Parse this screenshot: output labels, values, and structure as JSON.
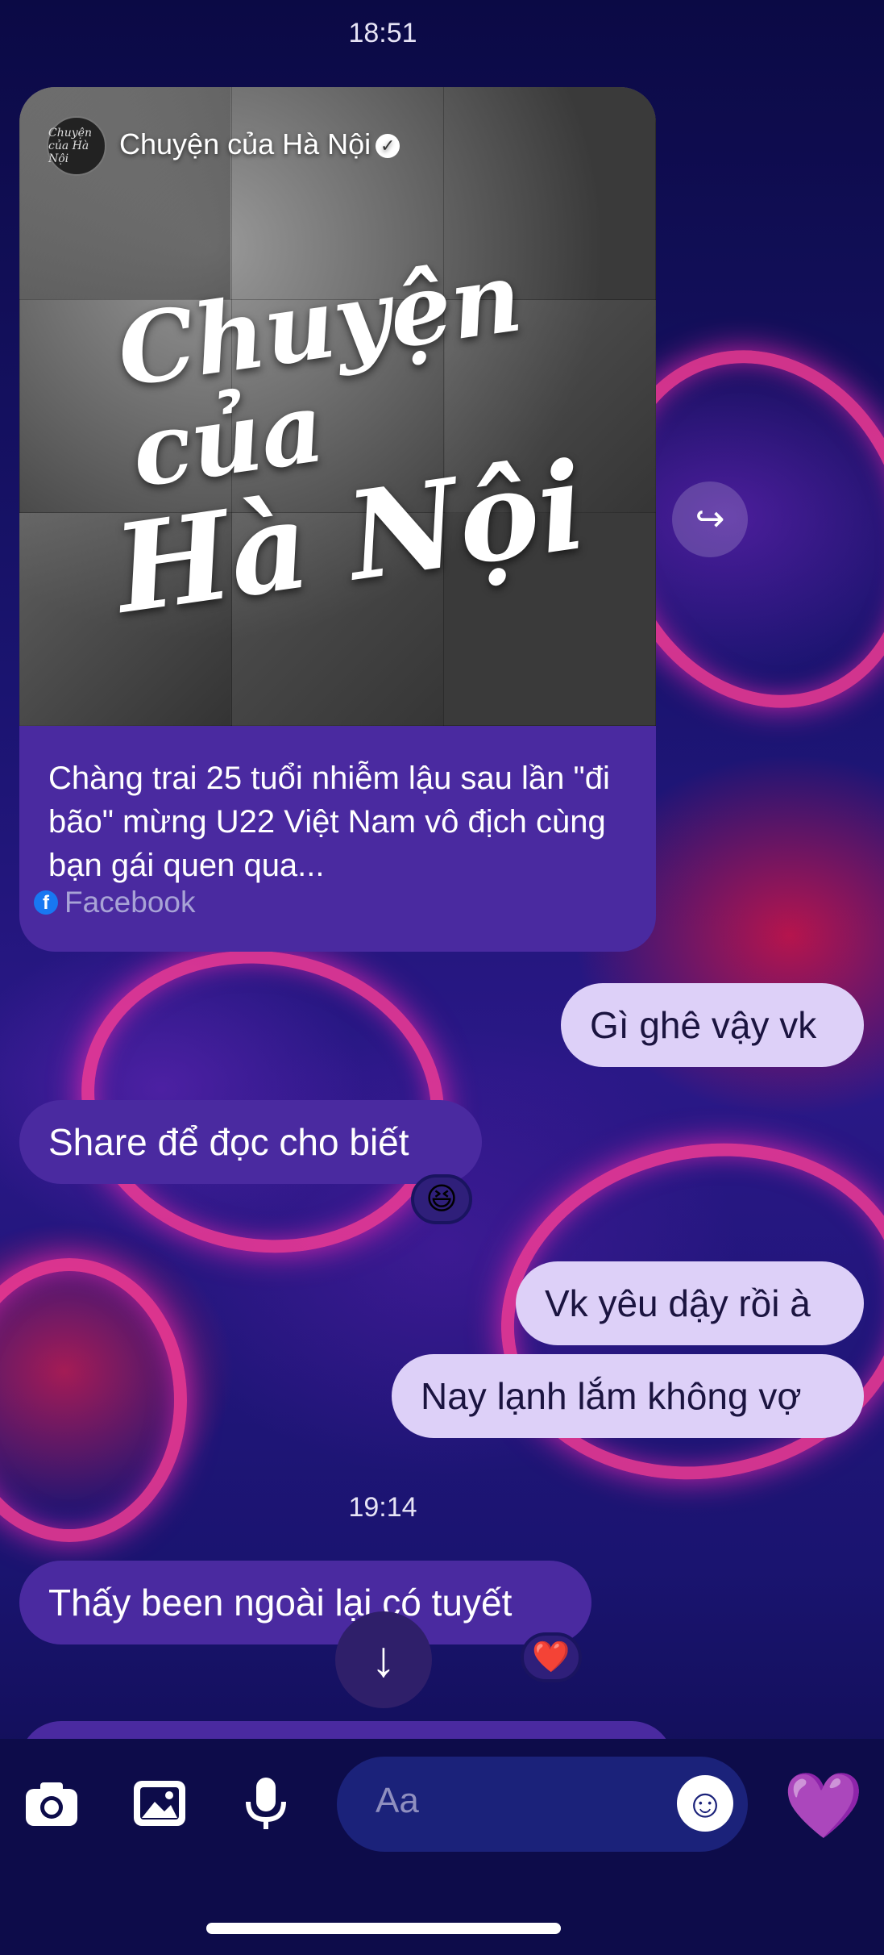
{
  "status": {
    "time_top": "18:51",
    "time_mid": "19:14"
  },
  "shared_card": {
    "author": "Chuyện của Hà Nội",
    "logo_text": "Chuyện của Hà Nội",
    "art_line1": "Chuyện của",
    "art_line2": "Hà Nội",
    "headline": "Chàng trai 25 tuổi nhiễm lậu sau lần \"đi bão\" mừng U22 Việt Nam vô địch cùng bạn gái quen qua...",
    "source": "Facebook"
  },
  "messages": [
    {
      "dir": "out",
      "text": "Gì ghê vậy vk"
    },
    {
      "dir": "in",
      "text": "Share để đọc cho biết",
      "reaction": "😆"
    },
    {
      "dir": "out",
      "text": "Vk yêu dậy rồi à"
    },
    {
      "dir": "out",
      "text": "Nay lạnh lắm không vợ"
    },
    {
      "dir": "in",
      "text": "Thấy been ngoài lại có tuyết",
      "reaction": "❤️"
    }
  ],
  "icons": {
    "share": "↪",
    "scroll_down": "↓",
    "camera": "camera-icon",
    "gallery": "image-icon",
    "mic": "mic-icon",
    "emoji": "☺",
    "like": "💜",
    "verified": "✓"
  },
  "composer": {
    "placeholder": "Aa"
  },
  "colors": {
    "outgoing_bubble": "#ddd0f8",
    "incoming_bubble": "#4a2aa0",
    "background": "#0d0b4a"
  }
}
